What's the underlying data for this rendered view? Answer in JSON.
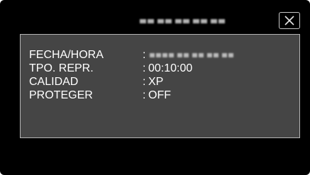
{
  "header": {
    "title_obscured": true
  },
  "close_button": {
    "icon": "close-icon"
  },
  "info": {
    "rows": [
      {
        "label": "FECHA/HORA",
        "colon": ":",
        "value": "",
        "value_obscured": true
      },
      {
        "label": "TPO. REPR.",
        "colon": ":",
        "value": "00:10:00"
      },
      {
        "label": "CALIDAD",
        "colon": ":",
        "value": "XP"
      },
      {
        "label": "PROTEGER",
        "colon": ":",
        "value": "OFF"
      }
    ]
  },
  "colors": {
    "screen_background": "#000000",
    "panel_background": "#454545",
    "panel_border": "#b4b4b4",
    "text": "#ffffff"
  }
}
